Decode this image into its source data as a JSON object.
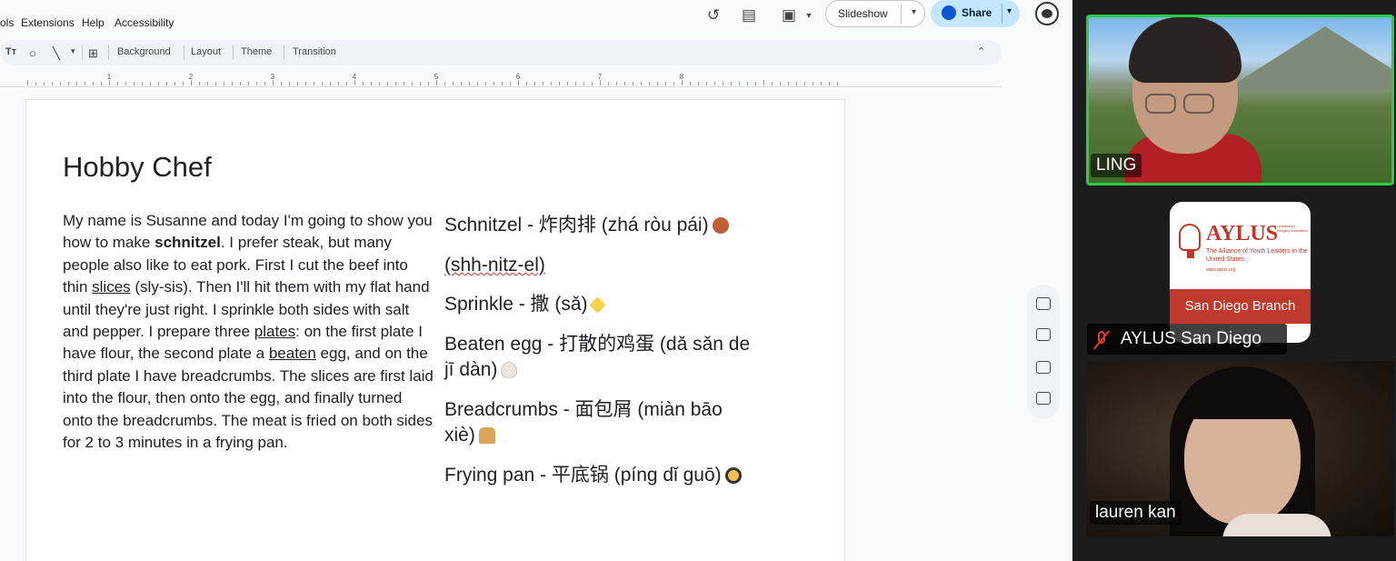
{
  "menu": {
    "tools": "ols",
    "extensions": "Extensions",
    "help": "Help",
    "accessibility": "Accessibility"
  },
  "top_actions": {
    "history_icon": "history-icon",
    "comments_icon": "comment-icon",
    "meet_icon": "video-camera-icon",
    "slideshow_label": "Slideshow",
    "share_label": "Share"
  },
  "toolbar": {
    "text_icon": "Tт",
    "background": "Background",
    "layout": "Layout",
    "theme": "Theme",
    "transition": "Transition"
  },
  "ruler": [
    "1",
    "2",
    "3",
    "4",
    "5",
    "6",
    "7",
    "8"
  ],
  "slide": {
    "title": "Hobby Chef",
    "body": {
      "p1": "My name is Susanne and today I'm going to show you how to make ",
      "bold": "schnitzel",
      "p2": ". I prefer steak, but many people also like to eat pork. First I cut the beef into thin ",
      "u1": "slices",
      "p3": " (sly-sis). Then I'll hit them with my flat hand until they're just right. I sprinkle both sides with salt and pepper. I prepare three ",
      "u2": "plates",
      "p4": ": on the first plate I have flour, the second plate a ",
      "u3": "beaten",
      "p5": " egg, and on the third plate I have breadcrumbs. The slices are first laid into the flour, then onto the egg, and finally turned onto the breadcrumbs. The meat is fried on both sides for 2 to 3 minutes in a frying pan."
    },
    "vocab": {
      "schnitzel": "Schnitzel - 炸肉排 (zhá ròu pái)",
      "schnitzel_pron": "(shh-nitz-el)",
      "sprinkle": "Sprinkle - 撒 (sǎ)",
      "egg_line1": "Beaten egg - 打散的鸡蛋 (dǎ sǎn de",
      "egg_line2": "jī dàn)",
      "bread_line1": "Breadcrumbs - 面包屑 (miàn bāo",
      "bread_line2": "xiè)",
      "pan": "Frying pan - 平底锅 (píng dǐ guō)"
    }
  },
  "call": {
    "p1": {
      "name": "LING"
    },
    "p2": {
      "name": "AYLUS San Diego",
      "logo": "AYLUS",
      "tagline": "The Alliance of Youth Leaders in the United States",
      "side": "Leadership Integrity Innovation",
      "url": "www.aylus.org",
      "branch": "San Diego Branch"
    },
    "p3": {
      "name": "lauren kan"
    }
  }
}
